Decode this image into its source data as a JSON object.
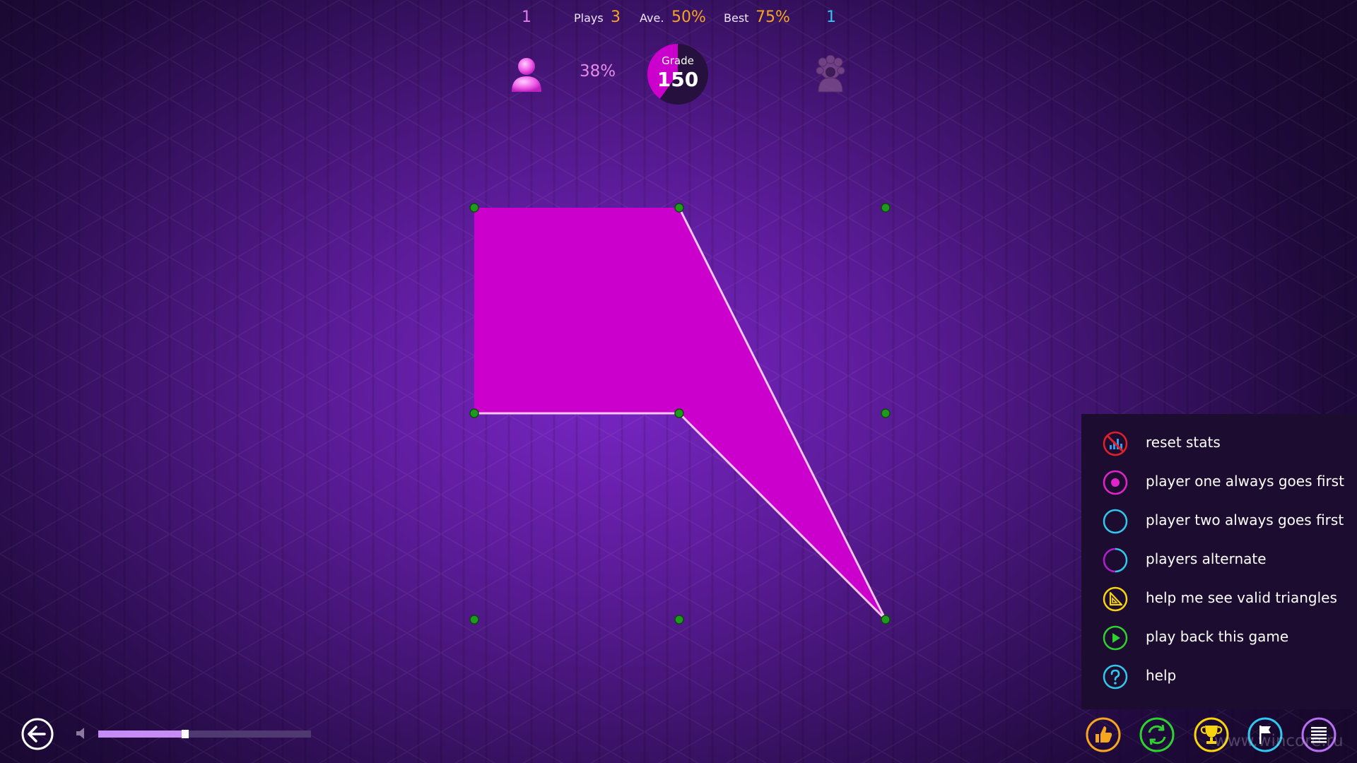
{
  "hud": {
    "player_one_wins": "1",
    "plays_label": "Plays",
    "plays_value": "3",
    "average_label": "Ave.",
    "average_value": "50%",
    "best_label": "Best",
    "best_value": "75%",
    "player_two_wins": "1",
    "player_one_percent": "38%",
    "grade_label": "Grade",
    "grade_value": "150",
    "grade_fill_fraction": 0.4
  },
  "colors": {
    "player_one": "#cc00cc",
    "player_two": "#30c8ee",
    "accent_orange": "#f6a51f",
    "dot": "#1f9a1f",
    "panel": "#1c0d30"
  },
  "board": {
    "dot_count": 9,
    "claimed_shape_color": "#cc00cc",
    "edge_color": "#f4c6f0"
  },
  "options_menu": {
    "items": [
      {
        "label": "reset stats",
        "icon": "reset-stats-icon",
        "color": "#e0202a"
      },
      {
        "label": "player one always goes first",
        "icon": "player-one-first-icon",
        "color": "#e024c8"
      },
      {
        "label": "player two always goes first",
        "icon": "player-two-first-icon",
        "color": "#30c8ee"
      },
      {
        "label": "players alternate",
        "icon": "players-alternate-icon",
        "color": "#b020c8"
      },
      {
        "label": "help me see valid triangles",
        "icon": "triangle-helper-icon",
        "color": "#f6d40e"
      },
      {
        "label": "play back this game",
        "icon": "play-icon",
        "color": "#2ed22e"
      },
      {
        "label": "help",
        "icon": "help-icon",
        "color": "#30c8ee"
      }
    ]
  },
  "bottom_bar": {
    "volume_fraction": 0.41,
    "buttons": [
      {
        "name": "thumbs-up-button",
        "icon": "thumbs-up-icon",
        "color": "#f6a51f"
      },
      {
        "name": "refresh-button",
        "icon": "refresh-icon",
        "color": "#2ed22e"
      },
      {
        "name": "trophy-button",
        "icon": "trophy-icon",
        "color": "#f6d40e"
      },
      {
        "name": "flag-button",
        "icon": "flag-icon",
        "color": "#30c8ee"
      },
      {
        "name": "menu-list-button",
        "icon": "list-icon",
        "color": "#b86ef0"
      }
    ]
  },
  "watermark": "www.wincore.ru"
}
